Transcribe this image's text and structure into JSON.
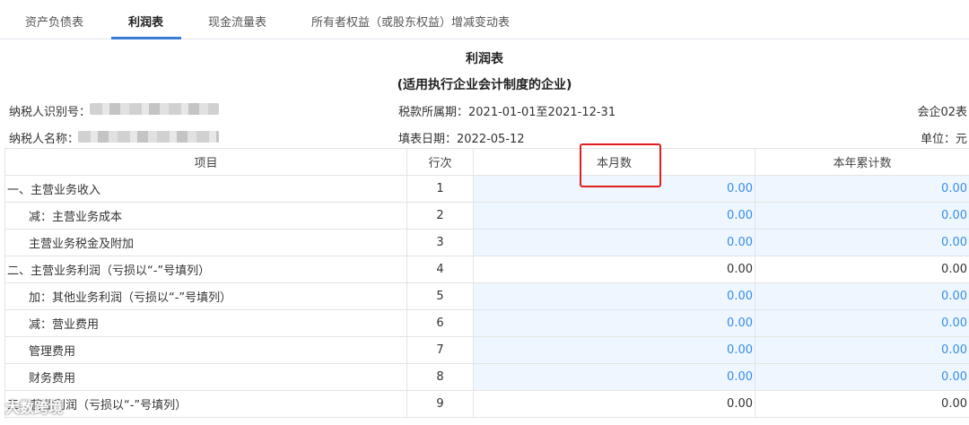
{
  "tabs": [
    {
      "label": "资产负债表",
      "active": false
    },
    {
      "label": "利润表",
      "active": true
    },
    {
      "label": "现金流量表",
      "active": false
    },
    {
      "label": "所有者权益（或股东权益）增减变动表",
      "active": false
    }
  ],
  "report": {
    "title": "利润表",
    "subtitle": "(适用执行企业会计制度的企业)",
    "taxpayer_id_label": "纳税人识别号：",
    "taxpayer_name_label": "纳税人名称：",
    "tax_period": "税款所属期：2021-01-01至2021-12-31",
    "fill_date": "填表日期：2022-05-12",
    "form_code": "会企02表",
    "unit": "单位：元"
  },
  "table": {
    "headers": {
      "item": "项目",
      "line": "行次",
      "month": "本月数",
      "ytd": "本年累计数"
    },
    "rows": [
      {
        "item": "一、主营业务收入",
        "line": "1",
        "month": "0.00",
        "ytd": "0.00"
      },
      {
        "item": "减：主营业务成本",
        "line": "2",
        "month": "0.00",
        "ytd": "0.00"
      },
      {
        "item": "主营业务税金及附加",
        "line": "3",
        "month": "0.00",
        "ytd": "0.00"
      },
      {
        "item": "二、主营业务利润（亏损以“-”号填列）",
        "line": "4",
        "month": "0.00",
        "ytd": "0.00"
      },
      {
        "item": "加：其他业务利润（亏损以“-”号填列）",
        "line": "5",
        "month": "0.00",
        "ytd": "0.00"
      },
      {
        "item": "减：营业费用",
        "line": "6",
        "month": "0.00",
        "ytd": "0.00"
      },
      {
        "item": "管理费用",
        "line": "7",
        "month": "0.00",
        "ytd": "0.00"
      },
      {
        "item": "财务费用",
        "line": "8",
        "month": "0.00",
        "ytd": "0.00"
      },
      {
        "item": "三、营业利润（亏损以“-”号填列）",
        "line": "9",
        "month": "0.00",
        "ytd": "0.00"
      }
    ]
  },
  "watermark": "大数跨境",
  "colors": {
    "accent": "#3a7bd5",
    "editable_bg": "#eef6ff",
    "editable_text": "#3a8ee6",
    "highlight": "#e02020"
  }
}
